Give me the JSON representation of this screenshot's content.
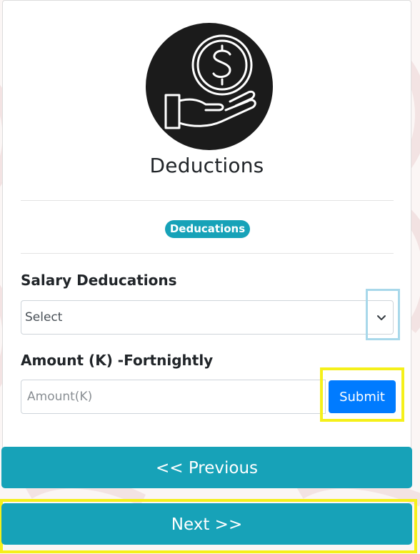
{
  "page": {
    "title": "Deductions",
    "badge": "Deducations"
  },
  "salary_deductions": {
    "label": "Salary Deducations",
    "selected_value": "Select"
  },
  "amount": {
    "label": "Amount (K) -Fortnightly",
    "placeholder": "Amount(K)",
    "value": ""
  },
  "buttons": {
    "submit": "Submit",
    "previous": "<< Previous",
    "next": "Next >>"
  },
  "icons": {
    "logo": "dollar-hand-icon",
    "select_arrow": "chevron-down-icon"
  },
  "colors": {
    "teal": "#17a2b8",
    "primary": "#007bff",
    "highlight_yellow": "#f5f01a",
    "highlight_blue": "#a8d8ea"
  }
}
